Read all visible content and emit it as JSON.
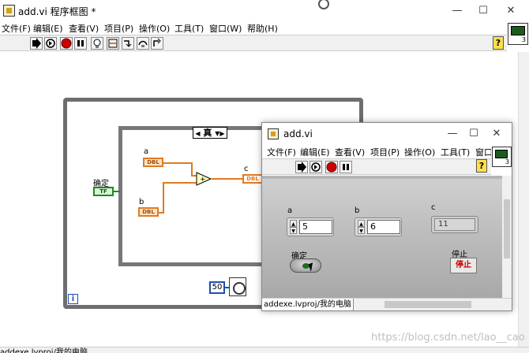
{
  "main_window": {
    "title": "add.vi 程序框图 *",
    "controls": {
      "minimize": "—",
      "maximize": "☐",
      "close": "✕"
    }
  },
  "main_menu": [
    "文件(F)",
    "编辑(E)",
    "查看(V)",
    "项目(P)",
    "操作(O)",
    "工具(T)",
    "窗口(W)",
    "帮助(H)"
  ],
  "main_toolbar": {
    "buttons": [
      "run-arrow-icon",
      "run-continuous-icon",
      "abort-icon",
      "pause-icon",
      "highlight-bulb-icon",
      "retain-wire-icon",
      "step-into-icon",
      "step-over-icon",
      "step-out-icon"
    ],
    "help": "?"
  },
  "vi_icon": {
    "number": "3"
  },
  "block_diagram": {
    "case_selector": "真",
    "label_a": "a",
    "label_b": "b",
    "label_c": "c",
    "label_ok": "确定",
    "term_dbl": "DBL",
    "term_tf": "TF",
    "wait_const": "50",
    "loop_index": "i"
  },
  "status_path": "addexe.lvproj/我的电脑",
  "watermark": "https://blog.csdn.net/lao__cao",
  "front_panel": {
    "title": "add.vi",
    "controls": {
      "minimize": "—",
      "maximize": "☐",
      "close": "✕"
    },
    "menu": [
      "文件(F)",
      "编辑(E)",
      "查看(V)",
      "项目(P)",
      "操作(O)",
      "工具(T)",
      "窗口"
    ],
    "help": "?",
    "vi_icon_number": "3",
    "label_a": "a",
    "value_a": "5",
    "label_b": "b",
    "value_b": "6",
    "label_c": "c",
    "value_c": "11",
    "label_ok": "确定",
    "label_stop": "停止",
    "stop_text": "停止",
    "status_path": "addexe.lvproj/我的电脑"
  }
}
